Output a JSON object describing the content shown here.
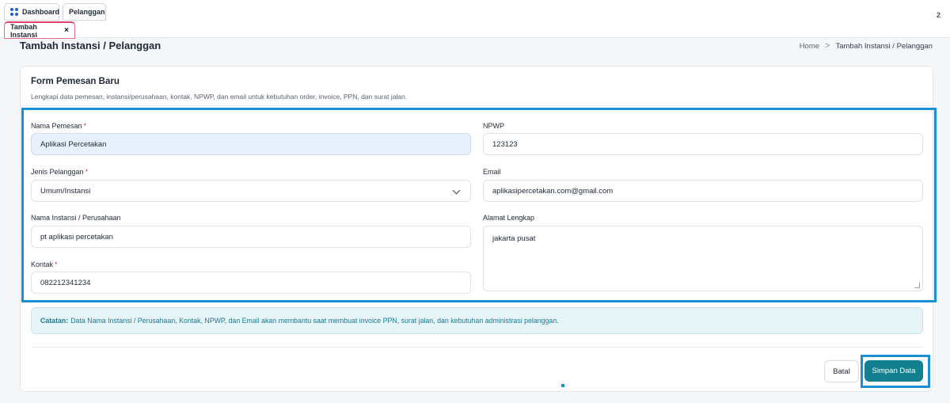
{
  "tabs": {
    "dashboard": "Dashboard",
    "pelanggan": "Pelanggan",
    "tambah": "Tambah Instansi",
    "close_glyph": "×"
  },
  "top_right_number": "2",
  "page_title": "Tambah Instansi / Pelanggan",
  "breadcrumb": {
    "home": "Home",
    "separator": ">",
    "current": "Tambah Instansi / Pelanggan"
  },
  "form": {
    "title": "Form Pemesan Baru",
    "description": "Lengkapi data pemesan, instansi/perusahaan, kontak, NPWP, dan email untuk kebutuhan order, invoice, PPN, dan surat jalan.",
    "required_mark": "*",
    "nama_pemesan": {
      "label": "Nama Pemesan",
      "value": "Aplikasi Percetakan"
    },
    "jenis_pelanggan": {
      "label": "Jenis Pelanggan",
      "value": "Umum/Instansi"
    },
    "nama_instansi": {
      "label": "Nama Instansi / Perusahaan",
      "value": "pt aplikasi percetakan"
    },
    "kontak": {
      "label": "Kontak",
      "value": "082212341234"
    },
    "npwp": {
      "label": "NPWP",
      "value": "123123"
    },
    "email": {
      "label": "Email",
      "value": "aplikasipercetakan.com@gmail.com"
    },
    "alamat": {
      "label": "Alamat Lengkap",
      "value": "jakarta pusat"
    }
  },
  "note": {
    "prefix": "Catatan:",
    "text": "Data Nama Instansi / Perusahaan, Kontak, NPWP, dan Email akan membantu saat membuat invoice PPN, surat jalan, dan kebutuhan administrasi pelanggan."
  },
  "buttons": {
    "batal": "Batal",
    "simpan": "Simpan Data"
  },
  "colors": {
    "accent": "#12808f",
    "highlight": "#1a8fd6",
    "required": "#e02f4f",
    "tab_active_border": "#e2406f"
  },
  "icons": {
    "dashboard": "dashboard-grid-icon",
    "close": "close-icon",
    "dropdown": "chevron-down-icon",
    "breadcrumb_sep": "chevron-right-icon"
  }
}
